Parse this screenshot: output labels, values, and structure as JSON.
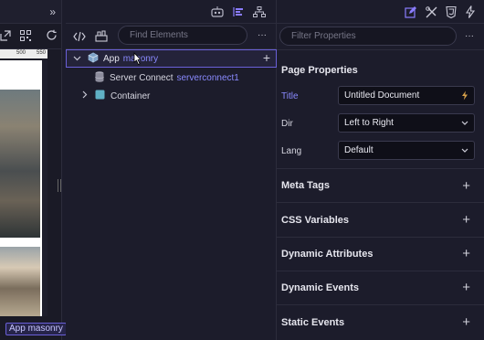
{
  "preview": {
    "collapse_label": "»",
    "ruler_label": "500",
    "ruler_label_2": "550",
    "badge": "App masonry",
    "icons": [
      "external-link-icon",
      "qr-code-icon",
      "refresh-icon"
    ]
  },
  "tree": {
    "header_icons": [
      "robot-icon",
      "align-icon",
      "sitemap-icon"
    ],
    "search_placeholder": "Find Elements",
    "more_label": "···",
    "items": [
      {
        "label": "App",
        "suffix": "masonry",
        "icon": "cube-icon"
      },
      {
        "label": "Server Connect",
        "suffix": "serverconnect1",
        "icon": "database-icon"
      },
      {
        "label": "Container",
        "suffix": "",
        "icon": "container-icon"
      }
    ],
    "add_label": "+"
  },
  "props": {
    "header_icons": [
      "edit-icon",
      "tools-icon",
      "css3-icon",
      "lightning-icon"
    ],
    "filter_placeholder": "Filter Properties",
    "more_label": "···",
    "page_properties_title": "Page Properties",
    "fields": {
      "title": {
        "label": "Title",
        "value": "Untitled Document"
      },
      "dir": {
        "label": "Dir",
        "value": "Left to Right"
      },
      "lang": {
        "label": "Lang",
        "value": "Default"
      }
    },
    "sections": [
      "Meta Tags",
      "CSS Variables",
      "Dynamic Attributes",
      "Dynamic Events",
      "Static Events"
    ],
    "add_label": "+"
  },
  "colors": {
    "accent": "#6a60d8",
    "bg": "#1c1c2b"
  }
}
